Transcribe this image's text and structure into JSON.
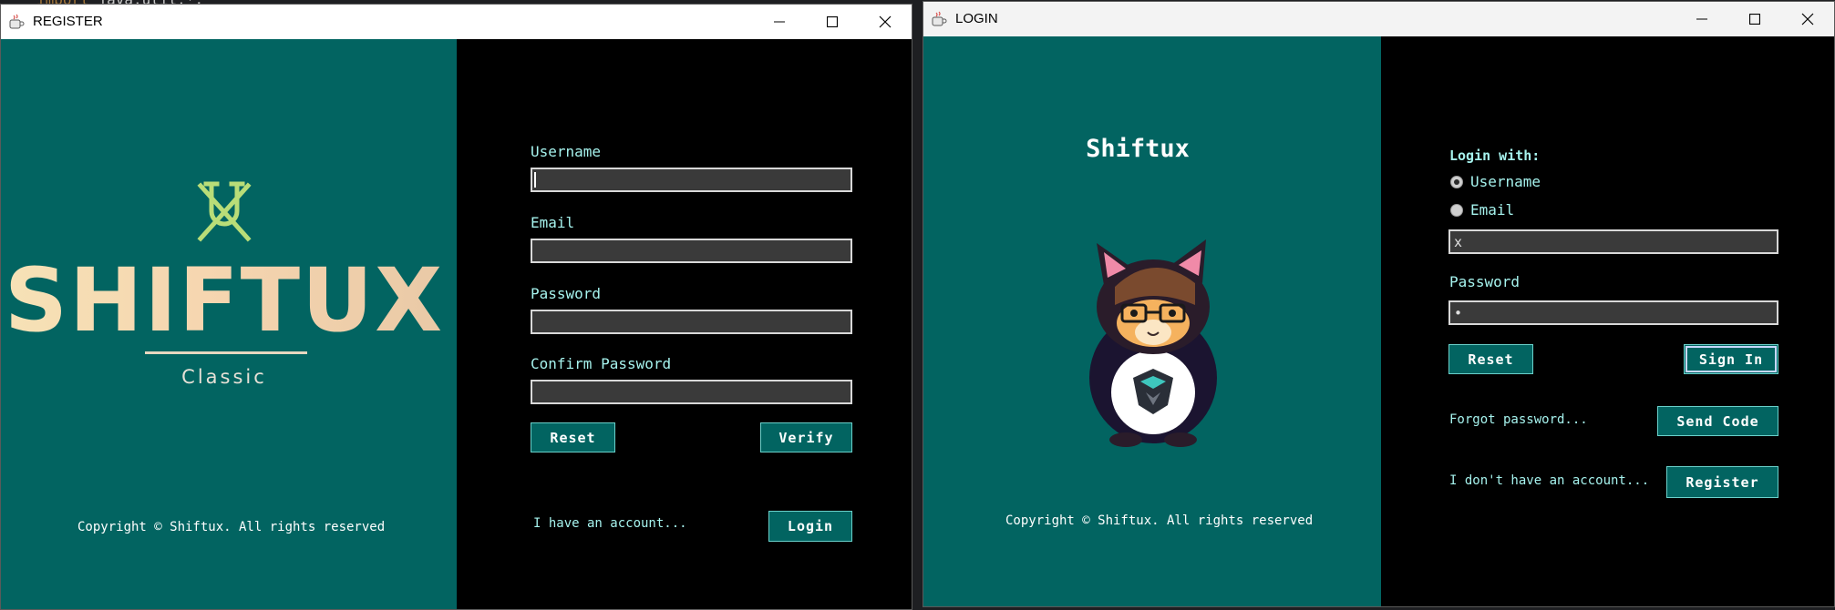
{
  "background_code": {
    "keyword": "import",
    "rest": "java.util.*;"
  },
  "register_window": {
    "title": "REGISTER",
    "logo": {
      "wordmark": "SHIFTUX",
      "subtitle": "Classic"
    },
    "copyright": "Copyright © Shiftux. All rights reserved",
    "form": {
      "username_label": "Username",
      "username_value": "",
      "email_label": "Email",
      "email_value": "",
      "password_label": "Password",
      "password_value": "",
      "confirm_password_label": "Confirm Password",
      "confirm_password_value": ""
    },
    "buttons": {
      "reset": "Reset",
      "verify": "Verify",
      "login": "Login"
    },
    "have_account_text": "I have an account..."
  },
  "login_window": {
    "title": "LOGIN",
    "brand_title": "Shiftux",
    "copyright": "Copyright © Shiftux. All rights reserved",
    "login_with_label": "Login with:",
    "radio_options": [
      {
        "label": "Username",
        "selected": true
      },
      {
        "label": "Email",
        "selected": false
      }
    ],
    "identifier_value": "x",
    "password_label": "Password",
    "password_value": "•",
    "buttons": {
      "reset": "Reset",
      "sign_in": "Sign In",
      "send_code": "Send Code",
      "register": "Register"
    },
    "forgot_password_text": "Forgot password...",
    "no_account_text": "I don't have an account..."
  },
  "colors": {
    "panel_teal": "#026461",
    "label_cyan": "#a6f3ee",
    "field_fill": "#3a3a3a",
    "wordmark": "#f6e2b6"
  },
  "icons": [
    "java-cup-icon",
    "minimize-icon",
    "maximize-icon",
    "close-icon",
    "shiftux-emblem-icon",
    "cat-mascot"
  ]
}
